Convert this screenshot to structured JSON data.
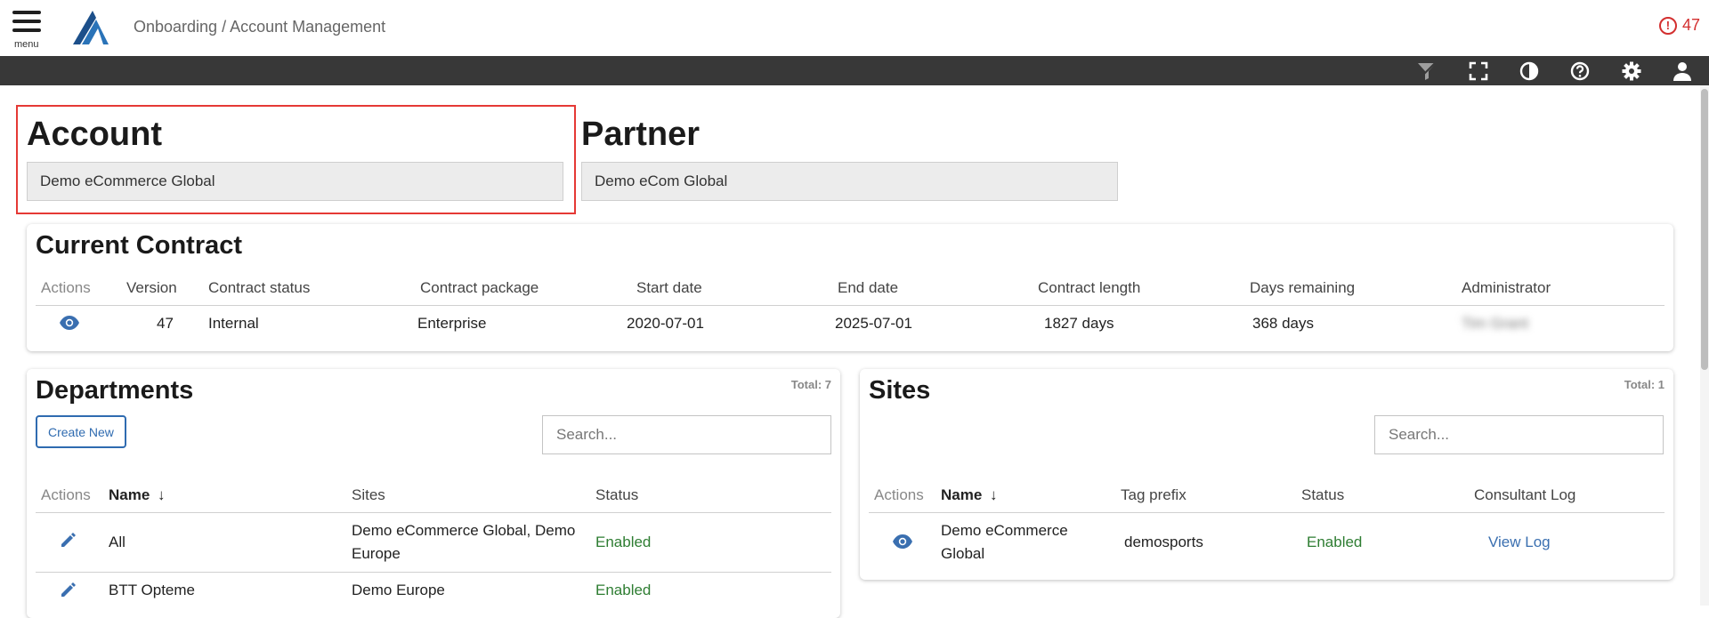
{
  "header": {
    "menu_label": "menu",
    "breadcrumb": "Onboarding / Account Management",
    "alert_count": "47",
    "alert_glyph": "!"
  },
  "toolbar": {
    "icons": [
      "filter-icon",
      "fullscreen-icon",
      "contrast-icon",
      "help-icon",
      "settings-icon",
      "user-icon"
    ]
  },
  "account": {
    "title": "Account",
    "value": "Demo eCommerce Global"
  },
  "partner": {
    "title": "Partner",
    "value": "Demo eCom Global"
  },
  "contract": {
    "title": "Current Contract",
    "columns": [
      "Actions",
      "Version",
      "Contract status",
      "Contract package",
      "Start date",
      "End date",
      "Contract length",
      "Days remaining",
      "Administrator"
    ],
    "row": {
      "version": "47",
      "status": "Internal",
      "package": "Enterprise",
      "start": "2020-07-01",
      "end": "2025-07-01",
      "length": "1827 days",
      "remaining": "368 days",
      "administrator": "Tim Grant"
    }
  },
  "departments": {
    "title": "Departments",
    "total": "Total: 7",
    "create_label": "Create New",
    "search_placeholder": "Search...",
    "columns": [
      "Actions",
      "Name",
      "Sites",
      "Status"
    ],
    "sort_glyph": "↓",
    "rows": [
      {
        "name": "All",
        "sites": "Demo eCommerce Global, Demo Europe",
        "status": "Enabled"
      },
      {
        "name": "BTT Opteme",
        "sites": "Demo Europe",
        "status": "Enabled"
      }
    ]
  },
  "sites": {
    "title": "Sites",
    "total": "Total: 1",
    "search_placeholder": "Search...",
    "columns": [
      "Actions",
      "Name",
      "Tag prefix",
      "Status",
      "Consultant Log"
    ],
    "sort_glyph": "↓",
    "rows": [
      {
        "name": "Demo eCommerce Global",
        "tag_prefix": "demosports",
        "status": "Enabled",
        "log": "View Log"
      }
    ]
  },
  "colors": {
    "toolbar": "#383838",
    "accent": "#2f6bb0",
    "enabled": "#2e7d32",
    "alert": "#d32f2f",
    "highlight": "#e53935"
  }
}
